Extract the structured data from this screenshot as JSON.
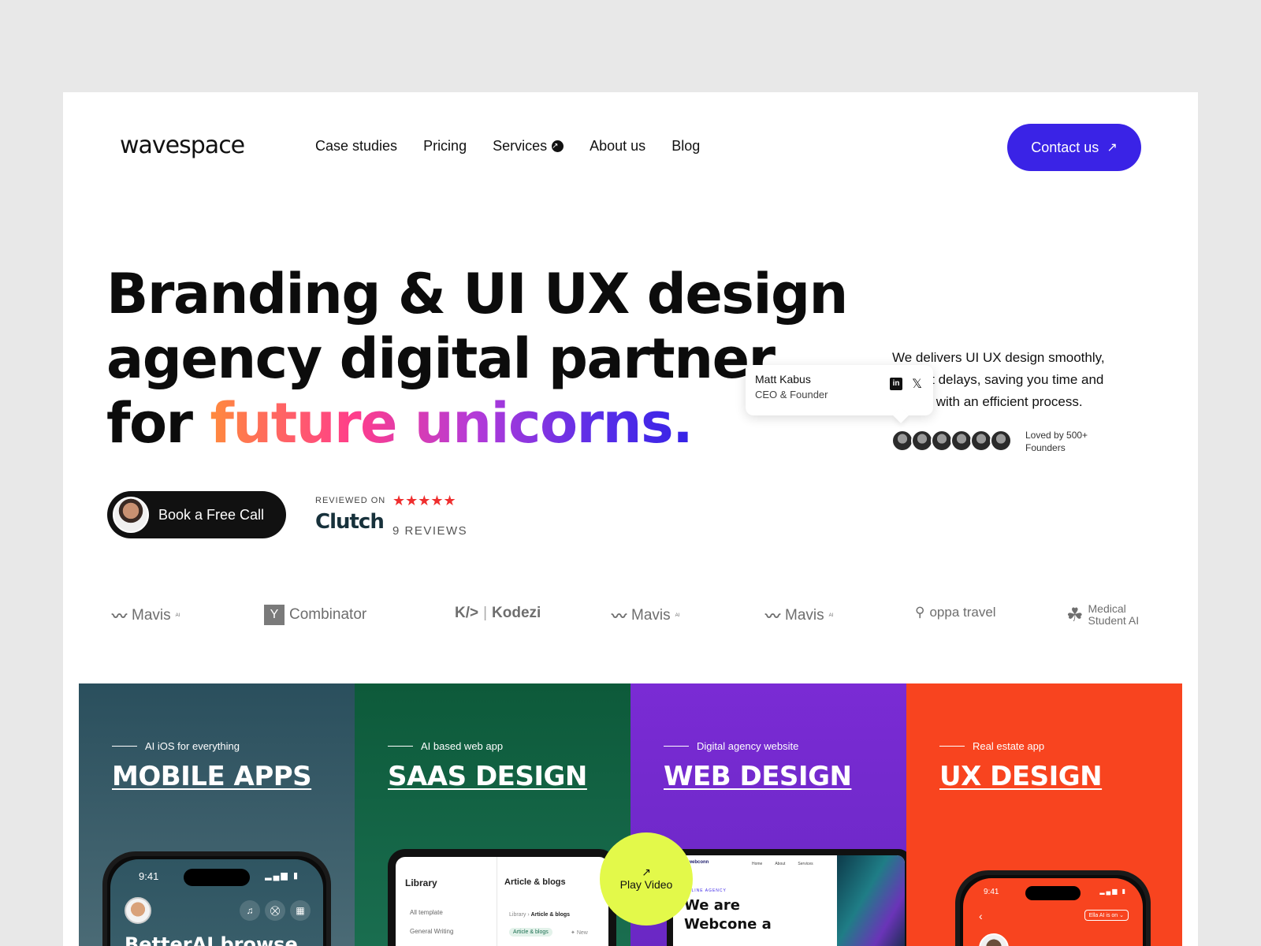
{
  "header": {
    "logo": "wavespace",
    "nav": [
      {
        "label": "Case studies"
      },
      {
        "label": "Pricing"
      },
      {
        "label": "Services"
      },
      {
        "label": "About us"
      },
      {
        "label": "Blog"
      }
    ],
    "contact_label": "Contact us"
  },
  "hero": {
    "line1": "Branding & UI UX design",
    "line2": "agency digital partner",
    "line3_plain": "for ",
    "line3_gradient": "future unicorns.",
    "book_label": "Book a Free Call",
    "clutch": {
      "reviewed": "REVIEWED ON",
      "logo": "Clutch",
      "stars": "★★★★★",
      "reviews": "9 REVIEWS"
    }
  },
  "testimonial": {
    "line1": "We delivers UI UX design smoothly,",
    "line2": "without delays, saving you time and",
    "line3": "money with an efficient process.",
    "name": "Matt Kabus",
    "role": "CEO & Founder",
    "loved_line1": "Loved by 500+",
    "loved_line2": "Founders"
  },
  "logos": [
    {
      "name": "Mavis",
      "suffix": "AI"
    },
    {
      "name": "Combinator",
      "mark": "Y"
    },
    {
      "name": "Kodezi",
      "mark": "K/>"
    },
    {
      "name": "Mavis",
      "suffix": "AI"
    },
    {
      "name": "Mavis",
      "suffix": "AI"
    },
    {
      "name": "oppa travel"
    },
    {
      "name_line1": "Medical",
      "name_line2": "Student AI"
    }
  ],
  "cards": [
    {
      "tag": "AI iOS for everything",
      "title": "MOBILE APPS",
      "phone_time": "9:41",
      "phone_heading": "BetterAI browse"
    },
    {
      "tag": "AI based web app",
      "title": "SAAS DESIGN",
      "library": "Library",
      "articles": "Article & blogs",
      "all_template": "All template",
      "general_writing": "General Writing",
      "breadcrumb_root": "Library",
      "breadcrumb_leaf": "Article & blogs",
      "tag_label": "Article & blogs",
      "new_label": "New"
    },
    {
      "tag": "Digital agency website",
      "title": "WEB DESIGN",
      "site_logo": "webconn",
      "site_nav": [
        "Home",
        "About",
        "Services"
      ],
      "kicker": "ONLINE AGENCY",
      "hero_line1": "We are",
      "hero_line2": "Webcone a"
    },
    {
      "tag": "Real estate app",
      "title": "UX DESIGN",
      "phone_time": "9:41",
      "pill": "Ella AI is on"
    }
  ],
  "play_label": "Play Video",
  "colors": {
    "accent": "#3a23e6",
    "play": "#e3f94a",
    "card_mobile": "#2a4f5d",
    "card_saas": "#0d5a3a",
    "card_web": "#7a2bd4",
    "card_ux": "#f8441f"
  }
}
